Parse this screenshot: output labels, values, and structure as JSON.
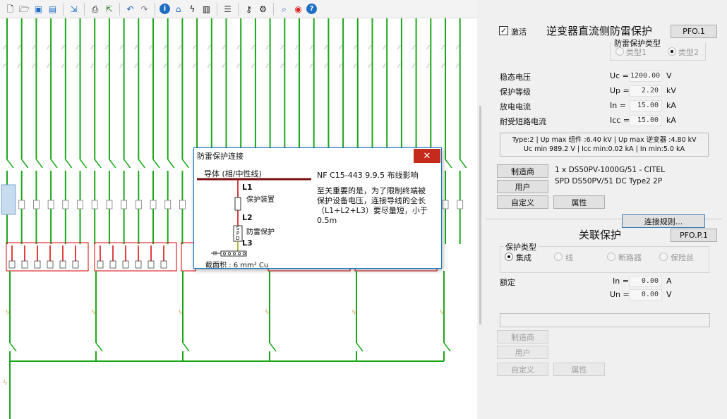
{
  "toolbar": {
    "icons": [
      "new-file-icon",
      "open-folder-icon",
      "save-icon",
      "save-as-icon",
      "import-icon",
      "print-icon",
      "export-icon",
      "undo-icon",
      "redo-icon",
      "info-icon",
      "home-icon",
      "lightning-icon",
      "chart-icon",
      "database-icon",
      "wrench-icon",
      "gear-icon",
      "zoom-icon",
      "help-ring-icon",
      "help-icon"
    ]
  },
  "panel": {
    "activate_label": "激活",
    "dc_title": "逆变器直流侧防雷保护",
    "pfo_button": "PFO.1",
    "protection_type_label": "防雷保护类型",
    "type1": "类型1",
    "type2": "类型2",
    "params": [
      {
        "name": "稳态电压",
        "sym": "Uc =",
        "value": "1200.00",
        "unit": "V"
      },
      {
        "name": "保护等级",
        "sym": "Up =",
        "value": "2.20",
        "unit": "kV"
      },
      {
        "name": "放电电流",
        "sym": "In =",
        "value": "15.00",
        "unit": "kA"
      },
      {
        "name": "耐受短路电流",
        "sym": "Icc =",
        "value": "15.00",
        "unit": "kA"
      }
    ],
    "summary_line1": "Type:2 | Up max 组件 :6.40  kV | Up max 逆变器 :4.80 kV",
    "summary_line2": "Uc min 989.2 V | Icc min:0.02 kA | In min:5.0 kA",
    "manufacturer_button": "制造商",
    "user_button": "用户",
    "custom_button": "自定义",
    "properties_button": "属性",
    "product_line1": "1 x DS50PV-1000G/51 - CITEL",
    "product_line2": "SPD DS50PV/51 DC Type2 2P",
    "connection_rules_button": "连接规则...",
    "assoc_title": "关联保护",
    "pfop_button": "PFO.P.1",
    "assoc_type_label": "保护类型",
    "assoc_options": [
      "集成",
      "线",
      "断路器",
      "保险丝"
    ],
    "rated_label": "额定",
    "in_sym": "In =",
    "in_value": "0.00",
    "in_unit": "A",
    "un_sym": "Un =",
    "un_value": "0.00",
    "un_unit": "V",
    "manufacturer_button2": "制造商",
    "user_button2": "用户",
    "custom_button2": "自定义",
    "properties_button2": "属性"
  },
  "dialog": {
    "title": "防雷保护连接",
    "close": "✕",
    "conductor_label": "导体 (相/中性线)",
    "l1": "L1",
    "protective_device": "保护装置",
    "l2": "L2",
    "spd_text": "S P D",
    "surge_protection": "防雷保护",
    "l3": "L3",
    "cross_section": "截面积 : 6 mm² Cu",
    "norm_title": "NF C15-443 9.9.5 布线影响",
    "norm_text": "至关重要的是，为了限制终端被保护设备电压，连接导线的全长（L1+L2+L3）要尽量短，小于0.5m"
  },
  "colors": {
    "wire_green": "#1aa81a",
    "wire_red": "#d40000",
    "dialog_border": "#1979ca",
    "close_red": "#c42b1c"
  }
}
